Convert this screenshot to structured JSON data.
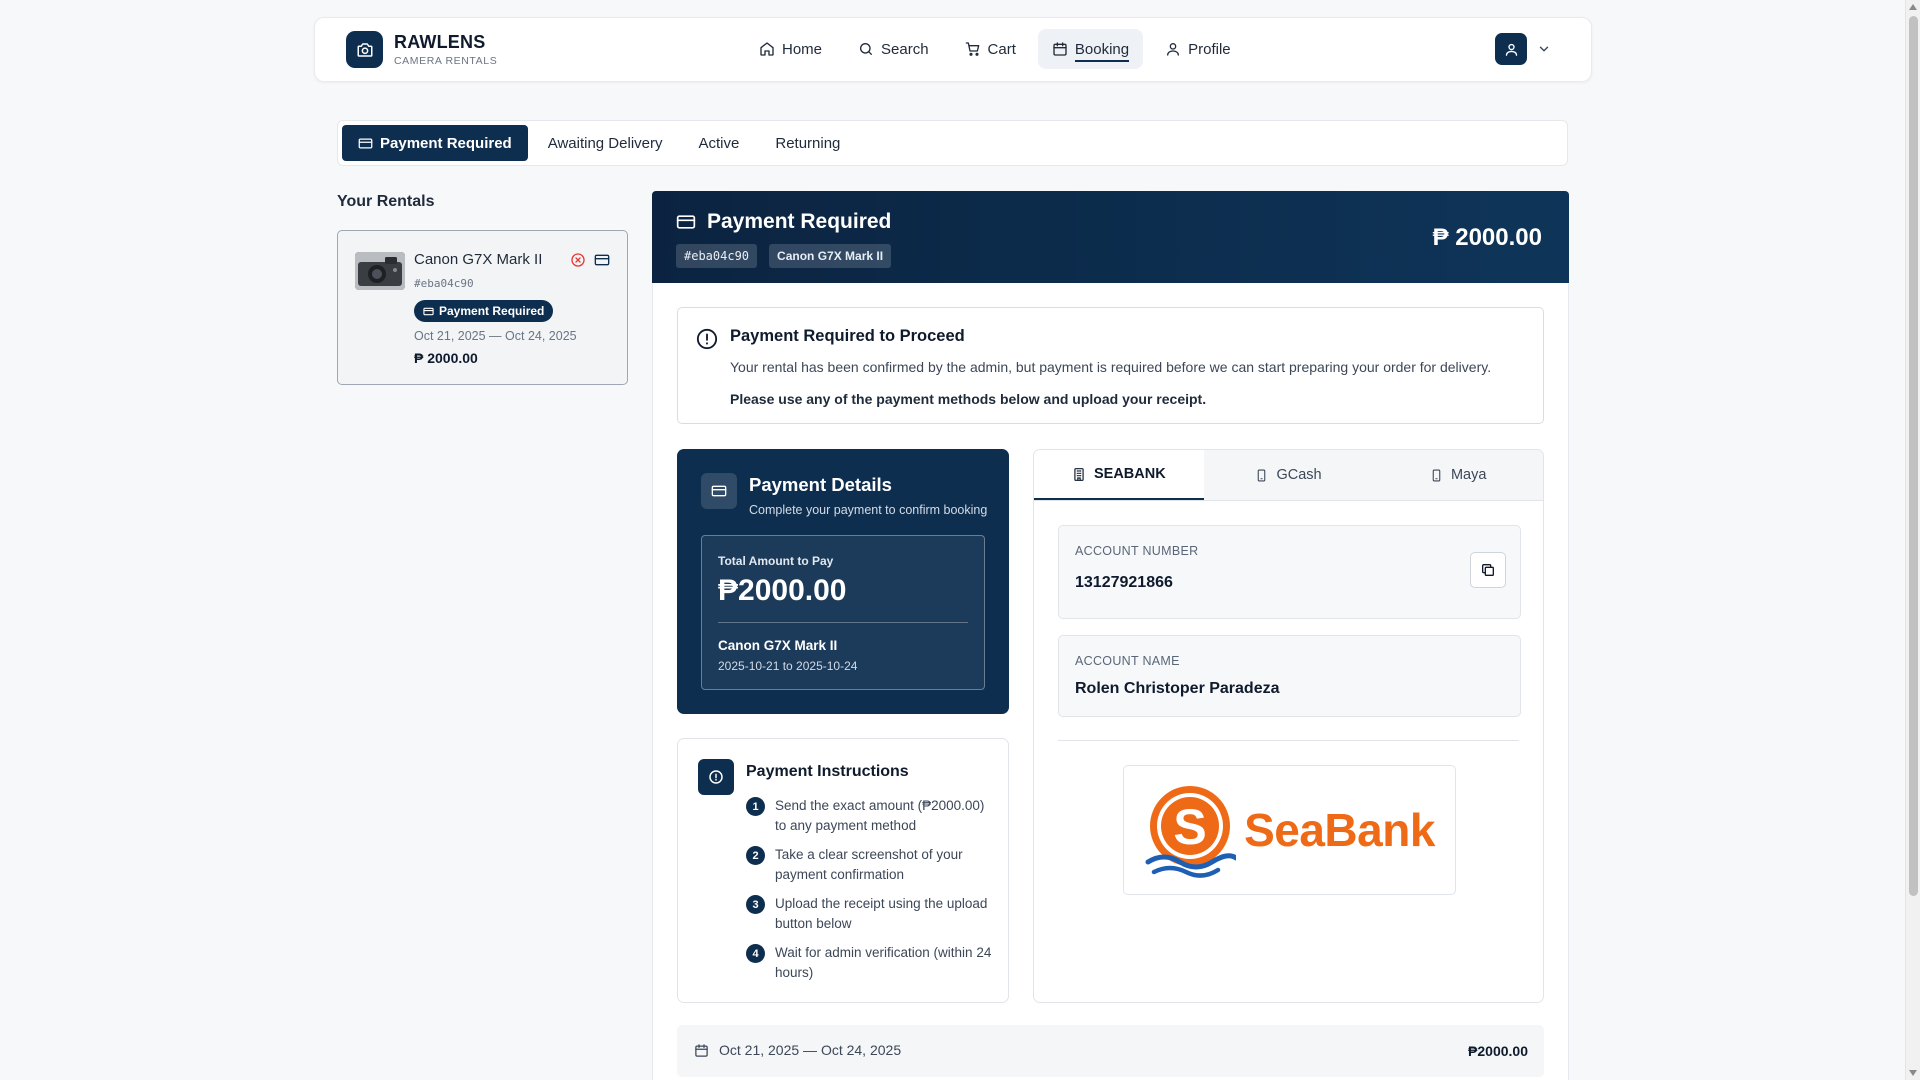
{
  "brand": {
    "name": "RAWLENS",
    "subtitle": "CAMERA RENTALS"
  },
  "nav": {
    "items": [
      {
        "label": "Home",
        "icon": "home-icon"
      },
      {
        "label": "Search",
        "icon": "search-icon"
      },
      {
        "label": "Cart",
        "icon": "cart-icon"
      },
      {
        "label": "Booking",
        "icon": "calendar-icon",
        "active": true
      },
      {
        "label": "Profile",
        "icon": "user-icon"
      }
    ]
  },
  "status_tabs": [
    {
      "label": "Payment Required",
      "active": true
    },
    {
      "label": "Awaiting Delivery"
    },
    {
      "label": "Active"
    },
    {
      "label": "Returning"
    }
  ],
  "rentals": {
    "title": "Your Rentals",
    "items": [
      {
        "name": "Canon G7X Mark II",
        "id": "#eba04c90",
        "badge": "Payment Required",
        "dates": "Oct 21, 2025 — Oct 24, 2025",
        "price": "₱ 2000.00"
      }
    ]
  },
  "main": {
    "title": "Payment Required",
    "tag_id": "#eba04c90",
    "tag_item": "Canon G7X Mark II",
    "amount": "₱ 2000.00"
  },
  "alert": {
    "title": "Payment Required to Proceed",
    "line1": "Your rental has been confirmed by the admin, but payment is required before we can start preparing your order for delivery.",
    "line2": "Please use any of the payment methods below and upload your receipt."
  },
  "payment_details": {
    "title": "Payment Details",
    "subtitle": "Complete your payment to confirm booking",
    "total_label": "Total Amount to Pay",
    "total_amount": "₱2000.00",
    "item": "Canon G7X Mark II",
    "range": "2025-10-21 to 2025-10-24"
  },
  "instructions": {
    "title": "Payment Instructions",
    "steps": [
      "Send the exact amount (₱2000.00) to any payment method",
      "Take a clear screenshot of your payment confirmation",
      "Upload the receipt using the upload button below",
      "Wait for admin verification (within 24 hours)"
    ]
  },
  "bank": {
    "tabs": [
      {
        "label": "SEABANK",
        "icon": "bank-icon",
        "active": true
      },
      {
        "label": "GCash",
        "icon": "phone-icon"
      },
      {
        "label": "Maya",
        "icon": "phone-icon"
      }
    ],
    "account_number_label": "ACCOUNT NUMBER",
    "account_number": "13127921866",
    "account_name_label": "ACCOUNT NAME",
    "account_name": "Rolen Christoper Paradeza",
    "logo_text": "SeaBank"
  },
  "summary": {
    "dates": "Oct 21, 2025 — Oct 24, 2025",
    "amount": "₱2000.00"
  },
  "colors": {
    "primary": "#0e2e4f",
    "seabank_orange": "#ef6a16",
    "cancel_red": "#e53935"
  }
}
